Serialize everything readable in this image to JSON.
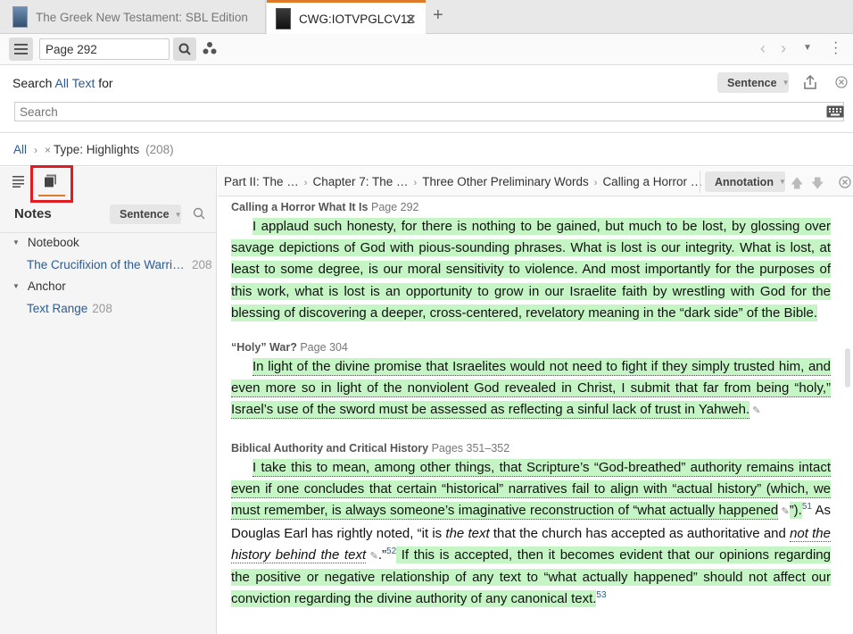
{
  "tabs": [
    {
      "title": "The Greek New Testament: SBL Edition"
    },
    {
      "title": "CWG:IOTVPGLCV12",
      "close": "✕"
    }
  ],
  "new_tab": "+",
  "toolbar": {
    "page_value": "Page 292"
  },
  "search": {
    "prefix": "Search",
    "scope": "All Text",
    "suffix": "for",
    "mode": "Sentence",
    "placeholder": "Search"
  },
  "filter": {
    "all": "All",
    "type": "Type: Highlights",
    "count": "(208)"
  },
  "notes_panel": {
    "title": "Notes",
    "mode": "Sentence",
    "tree": [
      {
        "label": "Notebook"
      },
      {
        "label": "The Crucifixion of the Warrior God",
        "count": "208"
      },
      {
        "label": "Anchor"
      },
      {
        "label": "Text Range",
        "count": "208"
      }
    ]
  },
  "breadcrumbs": [
    "Part II: The …",
    "Chapter 7: The …",
    "Three Other Preliminary Words",
    "Calling a Horror …"
  ],
  "annotation_mode": "Annotation",
  "entries": [
    {
      "heading": "Calling a Horror What It Is",
      "page": "Page 292",
      "body": "I applaud such honesty, for there is nothing to be gained, but much to be lost, by glossing over savage depictions of God with pious-sounding phrases. What is lost is our integrity. What is lost, at least to some degree, is our moral sensitivity to violence. And most importantly for the purposes of this work, what is lost is an opportunity to grow in our Israelite faith by wrestling with God for the blessing of discovering a deeper, cross-centered, revelatory meaning in the “dark side” of the Bible."
    },
    {
      "heading": "“Holy” War?",
      "page": "Page 304",
      "body": "In light of the divine promise that Israelites would not need to fight if they simply trusted him, and even more so in light of the nonviolent God revealed in Christ, I submit that far from being “holy,” Israel’s use of the sword must be assessed as reflecting a sinful lack of trust in Yahweh."
    },
    {
      "heading": "Biblical Authority and Critical History",
      "page": "Pages 351–352",
      "body_parts": [
        "I take this to mean, among other things, that Scripture’s “God-breathed” authority remains intact even if one concludes that certain “historical” narratives fail to align with “actual history” (which, we must remember, is always someone’s imaginative reconstruction of “what actually happened",
        "”).",
        "51",
        "As Douglas Earl has rightly noted, “it is ",
        "the text",
        " that the church has accepted as authoritative and ",
        "not the history behind the text",
        ".”",
        "52",
        " If this is accepted, then it becomes evident that our opinions regard­ing the positive or negative relationship of any text to “what actually happened” should not affect our conviction regarding the divine authority of any canonical text.",
        "53"
      ]
    }
  ]
}
